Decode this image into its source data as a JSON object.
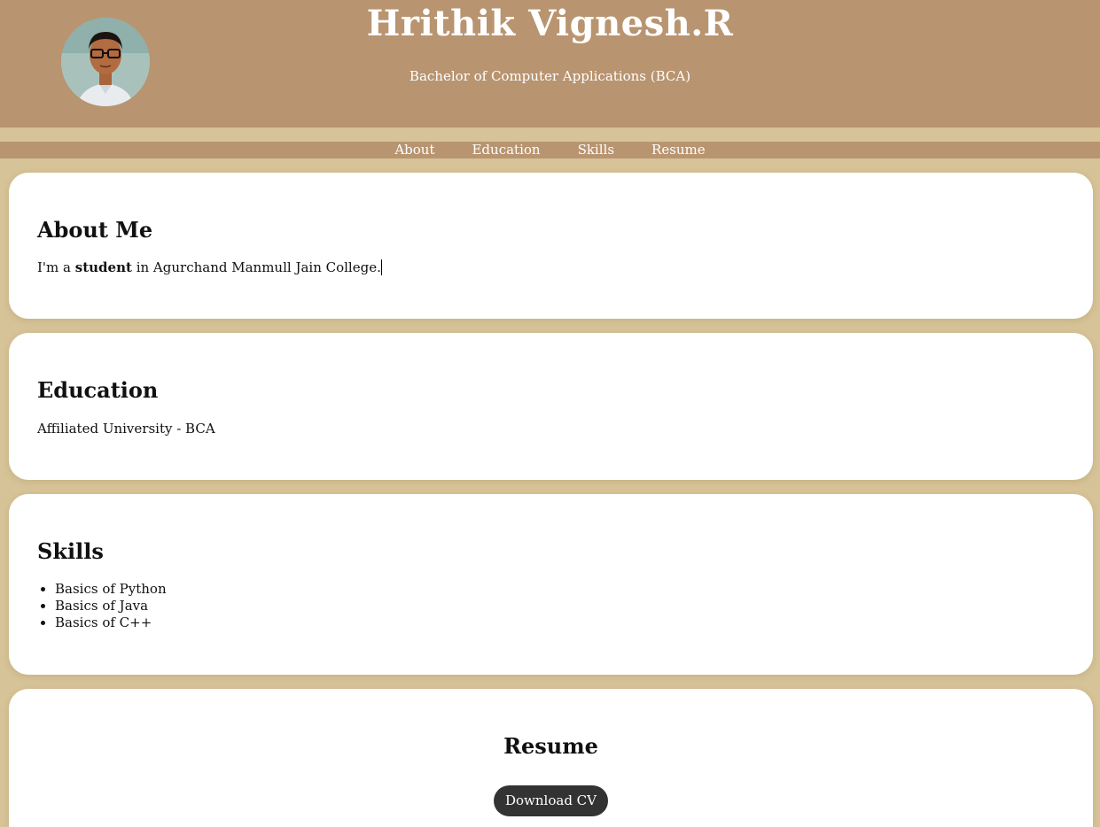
{
  "header": {
    "name": "Hrithik Vignesh.R",
    "degree": "Bachelor of Computer Applications (BCA)"
  },
  "nav": {
    "items": [
      {
        "label": "About"
      },
      {
        "label": "Education"
      },
      {
        "label": "Skills"
      },
      {
        "label": "Resume"
      }
    ]
  },
  "about": {
    "title": "About Me",
    "text_before": "I'm a",
    "text_bold": "student",
    "text_after": "in Agurchand Manmull Jain College."
  },
  "education": {
    "title": "Education",
    "text": "Affiliated University - BCA"
  },
  "skills": {
    "title": "Skills",
    "items": [
      "Basics of Python",
      "Basics of Java",
      "Basics of C++"
    ]
  },
  "resume": {
    "title": "Resume",
    "button_label": "Download CV"
  },
  "colors": {
    "header_bg": "#b89470",
    "page_bg": "#d6c397",
    "button_bg": "#333333"
  }
}
